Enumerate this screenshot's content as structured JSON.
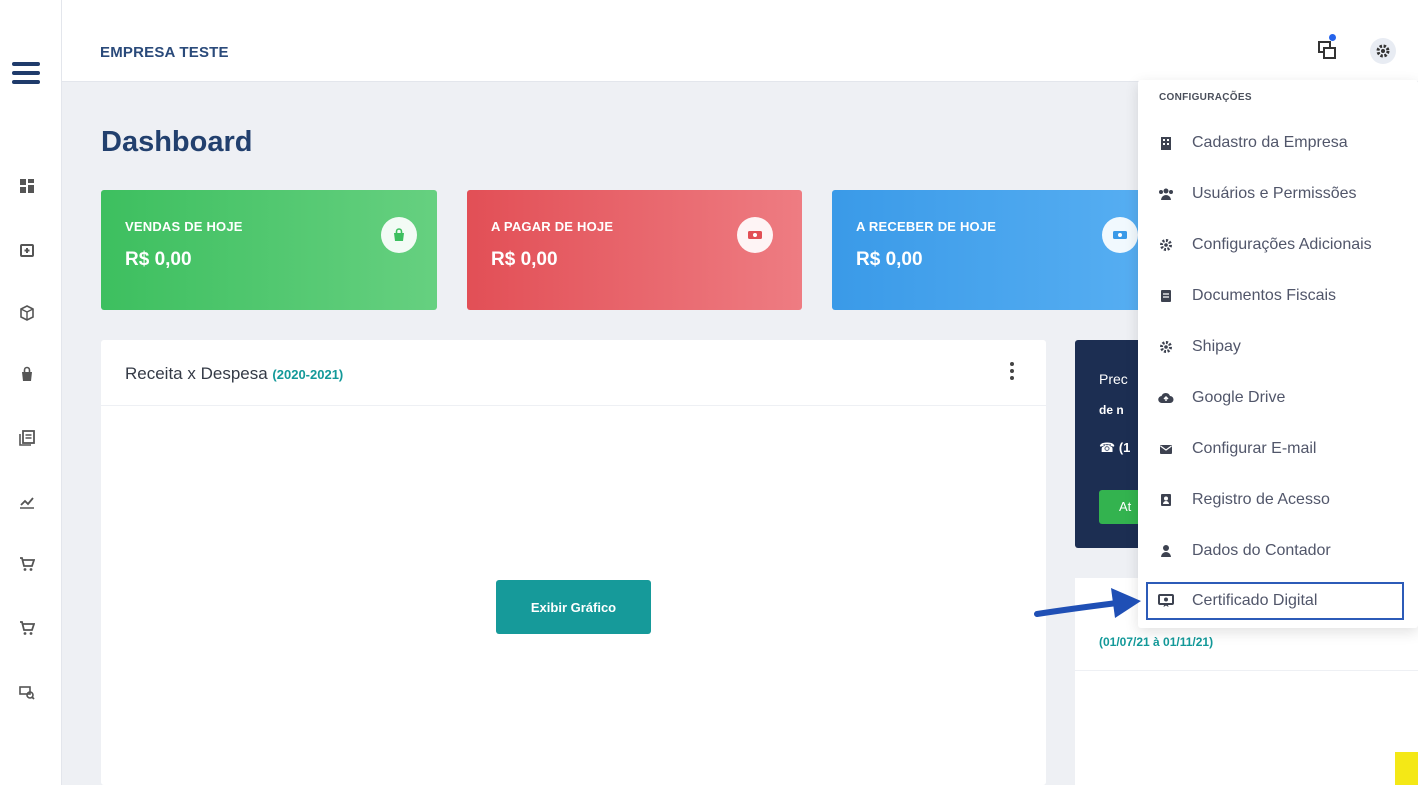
{
  "header": {
    "company": "EMPRESA TESTE"
  },
  "page": {
    "title": "Dashboard"
  },
  "cards": [
    {
      "label": "VENDAS DE HOJE",
      "value": "R$ 0,00",
      "color": "#3dbf5f",
      "icon": "shopping-bag-icon"
    },
    {
      "label": "A PAGAR DE HOJE",
      "value": "R$ 0,00",
      "color": "#e24f56",
      "icon": "money-icon"
    },
    {
      "label": "A RECEBER DE HOJE",
      "value": "R$ 0,00",
      "color": "#3a9ae8",
      "icon": "money-icon"
    }
  ],
  "panel": {
    "title": "Receita x Despesa",
    "range": "(2020-2021)",
    "button": "Exibir Gráfico"
  },
  "dark_card": {
    "line1": "Prec",
    "line2": "de n",
    "line3": "(1",
    "button": "At"
  },
  "right_panel": {
    "date_range": "(01/07/21 à 01/11/21)"
  },
  "dropdown": {
    "header": "CONFIGURAÇÕES",
    "items": [
      {
        "label": "Cadastro da Empresa",
        "icon": "building-icon"
      },
      {
        "label": "Usuários e Permissões",
        "icon": "users-icon"
      },
      {
        "label": "Configurações Adicionais",
        "icon": "gear-icon"
      },
      {
        "label": "Documentos Fiscais",
        "icon": "document-icon"
      },
      {
        "label": "Shipay",
        "icon": "gear-icon"
      },
      {
        "label": "Google Drive",
        "icon": "cloud-upload-icon"
      },
      {
        "label": "Configurar E-mail",
        "icon": "envelope-icon"
      },
      {
        "label": "Registro de Acesso",
        "icon": "id-card-icon"
      },
      {
        "label": "Dados do Contador",
        "icon": "user-icon"
      },
      {
        "label": "Certificado Digital",
        "icon": "certificate-icon"
      }
    ]
  },
  "colors": {
    "primary_dark": "#22406e",
    "teal": "#169a9a",
    "highlight_border": "#2c5bb8",
    "arrow": "#1f4fb5"
  }
}
